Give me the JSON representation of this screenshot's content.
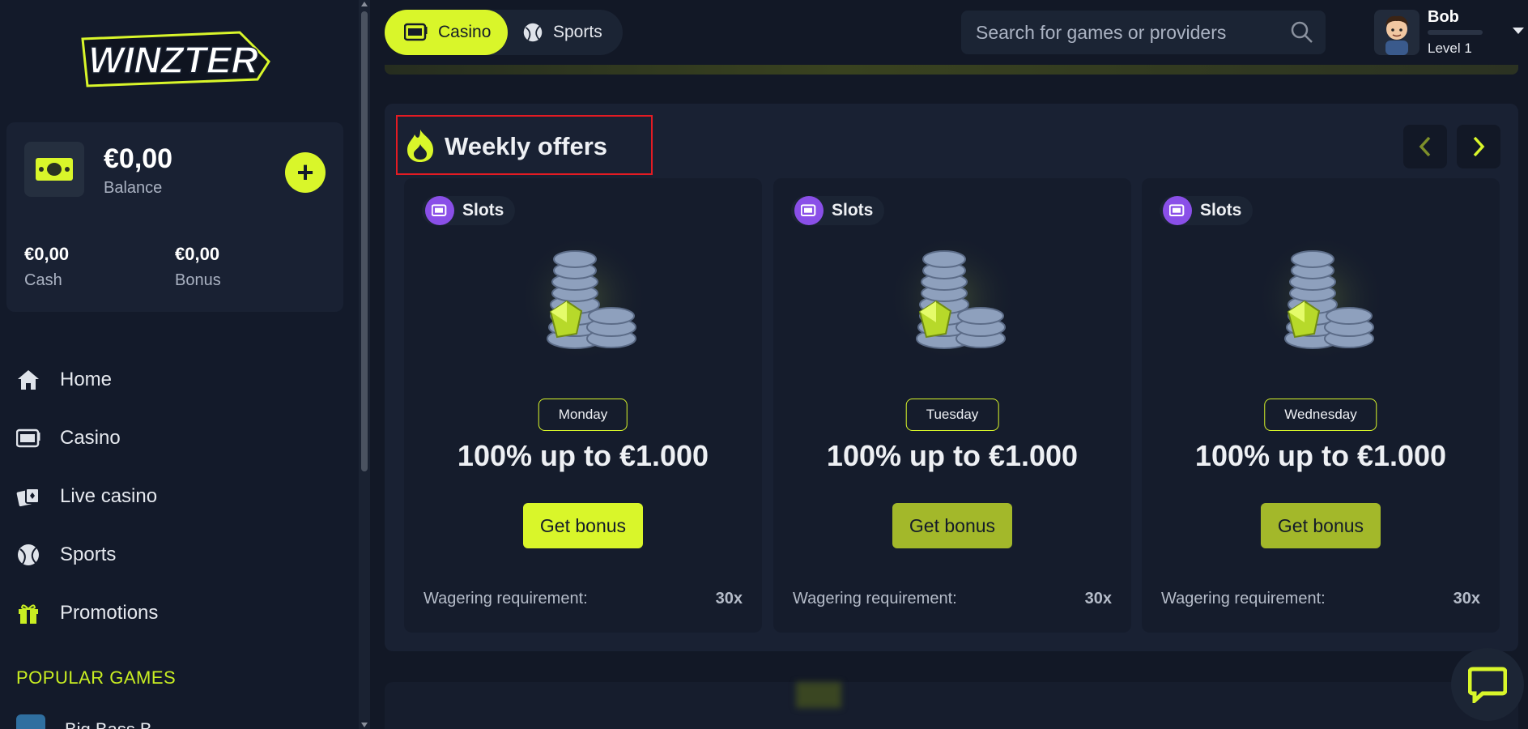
{
  "brand": {
    "logo_text": "WINZTER",
    "accent": "#d9f62a",
    "highlight_border": "#e31b23"
  },
  "wallet": {
    "balance": "€0,00",
    "balance_label": "Balance",
    "add_symbol": "+",
    "cash": "€0,00",
    "cash_label": "Cash",
    "bonus": "€0,00",
    "bonus_label": "Bonus"
  },
  "sidebar": {
    "items": [
      {
        "label": "Home",
        "icon": "home-icon"
      },
      {
        "label": "Casino",
        "icon": "slot-machine-icon"
      },
      {
        "label": "Live casino",
        "icon": "cards-icon"
      },
      {
        "label": "Sports",
        "icon": "ball-icon"
      },
      {
        "label": "Promotions",
        "icon": "gift-icon"
      }
    ],
    "popular_heading": "POPULAR GAMES",
    "popular_first": "Big Bass B..."
  },
  "topbar": {
    "casino_label": "Casino",
    "sports_label": "Sports",
    "search_placeholder": "Search for games or providers",
    "user_name": "Bob",
    "user_level": "Level 1"
  },
  "offers": {
    "title": "Weekly offers",
    "cards": [
      {
        "tag": "Slots",
        "day": "Monday",
        "offer": "100% up to €1.000",
        "button": "Get bonus",
        "wager_label": "Wagering requirement:",
        "wager_value": "30x",
        "button_color": "#d9f62a"
      },
      {
        "tag": "Slots",
        "day": "Tuesday",
        "offer": "100% up to €1.000",
        "button": "Get bonus",
        "wager_label": "Wagering requirement:",
        "wager_value": "30x",
        "button_color": "#a3b82a"
      },
      {
        "tag": "Slots",
        "day": "Wednesday",
        "offer": "100% up to €1.000",
        "button": "Get bonus",
        "wager_label": "Wagering requirement:",
        "wager_value": "30x",
        "button_color": "#a3b82a"
      }
    ]
  }
}
